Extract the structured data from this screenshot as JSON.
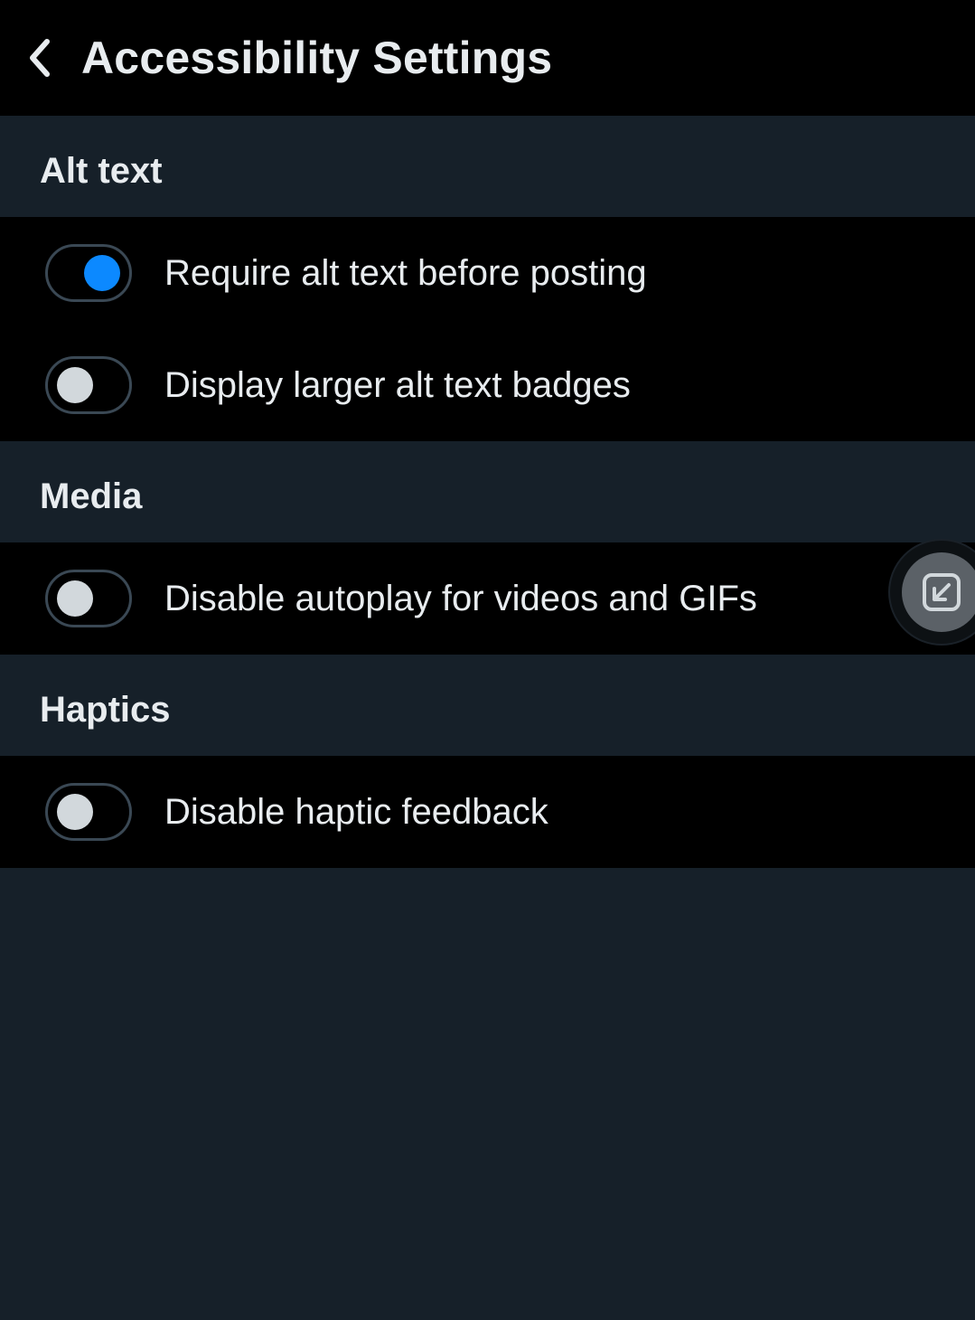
{
  "header": {
    "title": "Accessibility Settings"
  },
  "sections": [
    {
      "title": "Alt text",
      "items": [
        {
          "label": "Require alt text before posting",
          "enabled": true
        },
        {
          "label": "Display larger alt text badges",
          "enabled": false
        }
      ]
    },
    {
      "title": "Media",
      "items": [
        {
          "label": "Disable autoplay for videos and GIFs",
          "enabled": false
        }
      ]
    },
    {
      "title": "Haptics",
      "items": [
        {
          "label": "Disable haptic feedback",
          "enabled": false
        }
      ]
    }
  ]
}
